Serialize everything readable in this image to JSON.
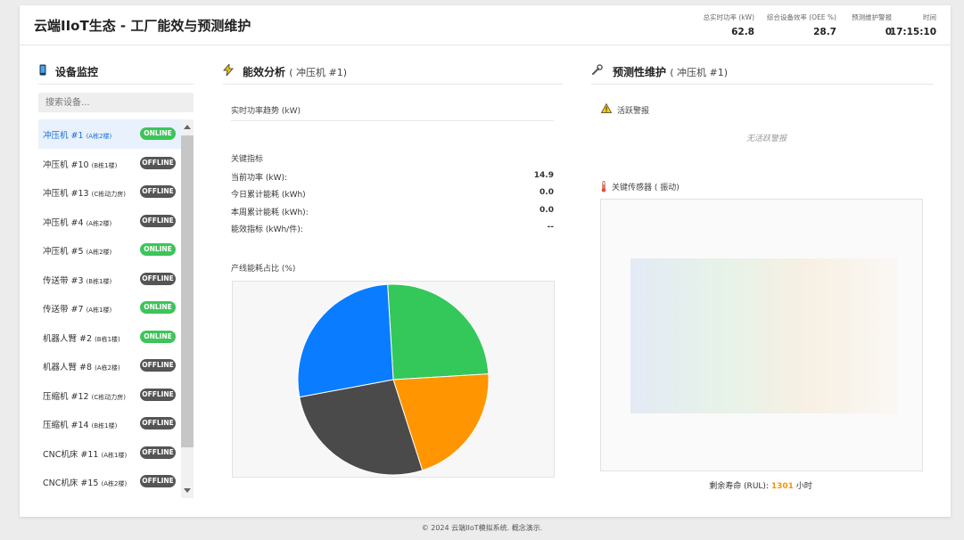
{
  "header": {
    "title": "云端IIoT生态 - 工厂能效与预测维护",
    "stats": [
      {
        "label": "总实时功率 (kW)",
        "value": "62.8"
      },
      {
        "label": "综合设备效率 (OEE %)",
        "value": "28.7"
      },
      {
        "label": "预测维护警报",
        "value": "0"
      },
      {
        "label": "时间",
        "value": "17:15:10"
      }
    ]
  },
  "devices": {
    "title": "设备监控",
    "search_placeholder": "搜索设备...",
    "items": [
      {
        "name": "冲压机 #1",
        "loc": "(A栋2楼)",
        "status": "ONLINE"
      },
      {
        "name": "冲压机 #10",
        "loc": "(B栋1楼)",
        "status": "OFFLINE"
      },
      {
        "name": "冲压机 #13",
        "loc": "(C栋动力房)",
        "status": "OFFLINE"
      },
      {
        "name": "冲压机 #4",
        "loc": "(A栋2楼)",
        "status": "OFFLINE"
      },
      {
        "name": "冲压机 #5",
        "loc": "(A栋2楼)",
        "status": "ONLINE"
      },
      {
        "name": "传送带 #3",
        "loc": "(B栋1楼)",
        "status": "OFFLINE"
      },
      {
        "name": "传送带 #7",
        "loc": "(A栋1楼)",
        "status": "ONLINE"
      },
      {
        "name": "机器人臂 #2",
        "loc": "(B栋1楼)",
        "status": "ONLINE"
      },
      {
        "name": "机器人臂 #8",
        "loc": "(A栋2楼)",
        "status": "OFFLINE"
      },
      {
        "name": "压缩机 #12",
        "loc": "(C栋动力房)",
        "status": "OFFLINE"
      },
      {
        "name": "压缩机 #14",
        "loc": "(B栋1楼)",
        "status": "OFFLINE"
      },
      {
        "name": "CNC机床 #11",
        "loc": "(A栋1楼)",
        "status": "OFFLINE"
      },
      {
        "name": "CNC机床 #15",
        "loc": "(A栋2楼)",
        "status": "OFFLINE"
      }
    ]
  },
  "energy": {
    "title": "能效分析",
    "device": "( 冲压机 #1)",
    "trend_label": "实时功率趋势 (kW)",
    "kpi_title": "关键指标",
    "kpis": [
      {
        "label": "当前功率 (kW):",
        "value": "14.9"
      },
      {
        "label": "今日累计能耗 (kWh)",
        "value": "0.0"
      },
      {
        "label": "本周累计能耗 (kWh):",
        "value": "0.0"
      },
      {
        "label": "能效指标 (kWh/件):",
        "value": "--"
      }
    ],
    "pie_label": "产线能耗占比 (%)"
  },
  "chart_data": {
    "type": "pie",
    "values": [
      25,
      21,
      27,
      27
    ],
    "colors": [
      "#34c759",
      "#ff9500",
      "#4a4a4a",
      "#0a7cff"
    ]
  },
  "predictive": {
    "title": "预测性维护",
    "device": "( 冲压机 #1)",
    "alerts_label": "活跃警报",
    "no_alerts": "无活跃警报",
    "sensor_label": "关键传感器 ( 振动)",
    "rul_label": "剩余寿命 (RUL):",
    "rul_value": "1301",
    "rul_unit": "小时"
  },
  "footer": {
    "text": "© 2024 云端IIoT模拟系统. 概念演示."
  }
}
